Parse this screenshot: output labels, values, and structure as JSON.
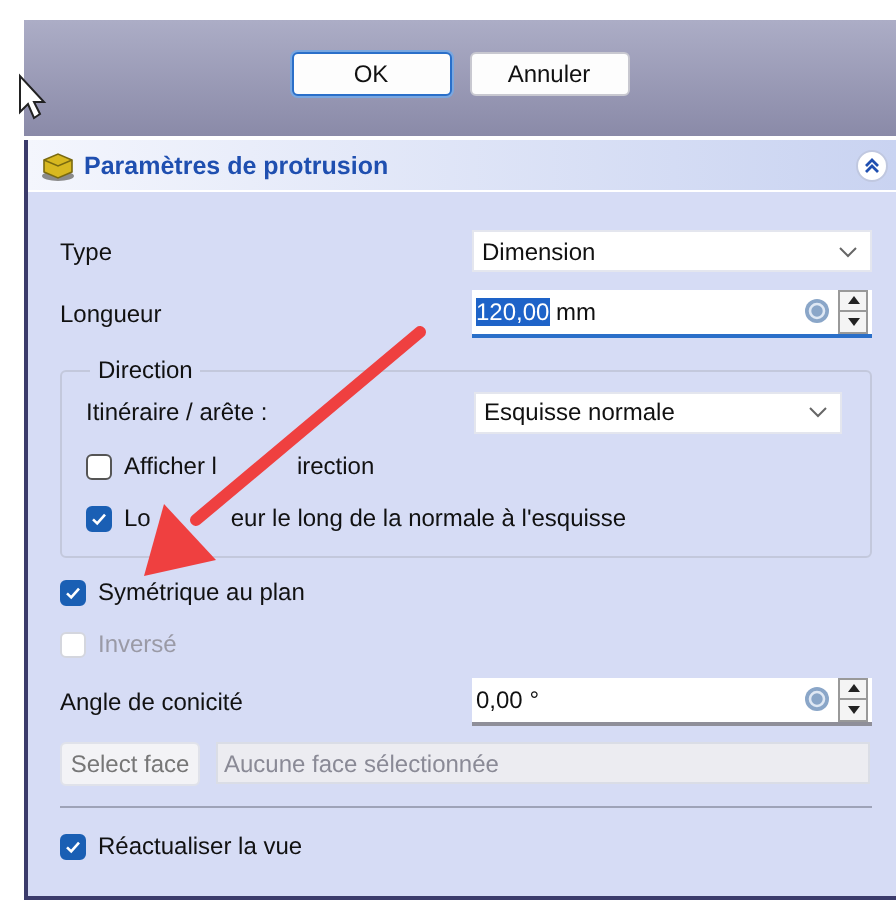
{
  "dialog_buttons": [
    {
      "label": "OK",
      "default": true
    },
    {
      "label": "Annuler",
      "default": false
    }
  ],
  "panel": {
    "title": "Paramètres de protrusion",
    "expanded": true
  },
  "fields": [
    {
      "kind": "combo",
      "label": "Type",
      "value": "Dimension"
    },
    {
      "kind": "quantity",
      "label": "Longueur",
      "value": "120,00",
      "unit": "mm",
      "selected": true
    }
  ],
  "direction": {
    "title": "Direction",
    "route": {
      "label": "Itinéraire / arête :",
      "value": "Esquisse normale"
    },
    "options": [
      {
        "label_parts": [
          "Afficher l",
          "irection"
        ],
        "checked": false
      },
      {
        "label_parts": [
          "Lo",
          "eur le long de la normale à l'esquisse"
        ],
        "checked": true
      }
    ]
  },
  "options": [
    {
      "label": "Symétrique au plan",
      "checked": true,
      "disabled": false
    },
    {
      "label": "Inversé",
      "checked": false,
      "disabled": true
    }
  ],
  "taper": {
    "label": "Angle de conicité",
    "value": "0,00",
    "unit": "°",
    "selected": false
  },
  "face": {
    "button": "Select face",
    "placeholder": "Aucune face sélectionnée"
  },
  "refresh": {
    "label": "Réactualiser la vue",
    "checked": true
  }
}
